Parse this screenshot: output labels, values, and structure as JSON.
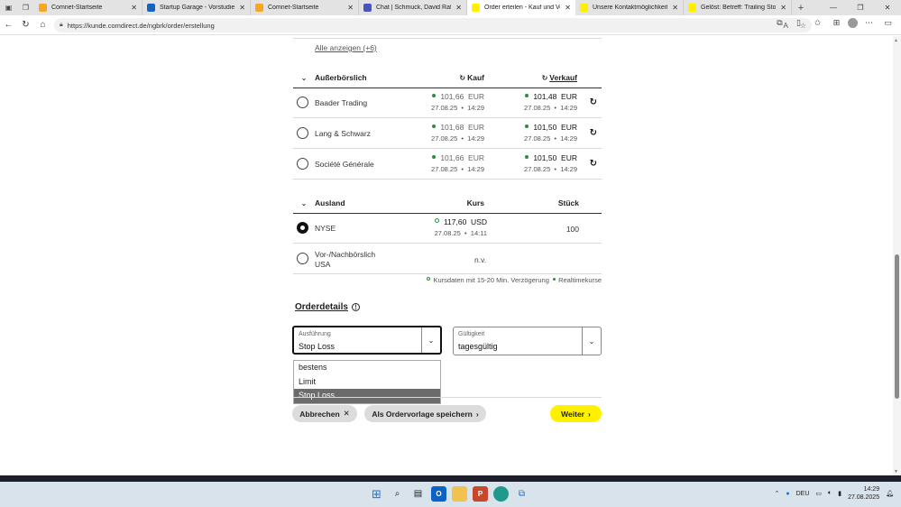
{
  "browser": {
    "tabs": [
      {
        "title": "Comnet-Startseite",
        "color": "#f5a623",
        "active": false
      },
      {
        "title": "Startup Garage - Vorstudie - Alli",
        "color": "#1565c0",
        "active": false
      },
      {
        "title": "Comnet-Startseite",
        "color": "#f5a623",
        "active": false
      },
      {
        "title": "Chat | Schmuck, David Rafael | M",
        "color": "#4b53bc",
        "active": false
      },
      {
        "title": "Order erteilen - Kauf und Verka",
        "color": "#fff000",
        "active": true
      },
      {
        "title": "Unsere Kontaktmöglichkeiten |",
        "color": "#fff000",
        "active": false
      },
      {
        "title": "Gelöst: Betreff: Trailing Stop-Lo",
        "color": "#fff000",
        "active": false
      }
    ],
    "url": "https://kunde.comdirect.de/ngbrk/order/erstellung"
  },
  "show_all_link": "Alle anzeigen (+6)",
  "offexchange": {
    "title": "Außerbörslich",
    "col_buy": "Kauf",
    "col_sell": "Verkauf",
    "rows": [
      {
        "name": "Baader Trading",
        "buy_price": "101,66",
        "buy_currency": "EUR",
        "buy_date": "27.08.25",
        "buy_time": "14:29",
        "sell_price": "101,48",
        "sell_currency": "EUR",
        "sell_date": "27.08.25",
        "sell_time": "14:29"
      },
      {
        "name": "Lang & Schwarz",
        "buy_price": "101,68",
        "buy_currency": "EUR",
        "buy_date": "27.08.25",
        "buy_time": "14:29",
        "sell_price": "101,50",
        "sell_currency": "EUR",
        "sell_date": "27.08.25",
        "sell_time": "14:29"
      },
      {
        "name": "Société Générale",
        "buy_price": "101,66",
        "buy_currency": "EUR",
        "buy_date": "27.08.25",
        "buy_time": "14:29",
        "sell_price": "101,50",
        "sell_currency": "EUR",
        "sell_date": "27.08.25",
        "sell_time": "14:29"
      }
    ]
  },
  "foreign": {
    "title": "Ausland",
    "col_price": "Kurs",
    "col_qty": "Stück",
    "rows": [
      {
        "name": "NYSE",
        "price": "117,60",
        "currency": "USD",
        "date": "27.08.25",
        "time": "14:11",
        "qty": "100",
        "selected": true
      },
      {
        "name_line1": "Vor-/Nachbörslich",
        "name_line2": "USA",
        "price": "n.v.",
        "selected": false
      }
    ]
  },
  "note": {
    "delayed": "Kursdaten mit 15-20 Min. Verzögerung",
    "realtime": "Realtimekurse"
  },
  "order_details": {
    "title": "Orderdetails",
    "execution": {
      "label": "Ausführung",
      "value": "Stop Loss"
    },
    "validity": {
      "label": "Gültigkeit",
      "value": "tagesgültig"
    },
    "options": [
      "bestens",
      "Limit",
      "Stop Loss"
    ],
    "selected_option": "Stop Loss"
  },
  "actions": {
    "cancel": "Abbrechen",
    "save_template": "Als Ordervorlage speichern",
    "next": "Weiter"
  },
  "taskbar": {
    "lang": "DEU",
    "time": "14:29",
    "date": "27.08.2025"
  }
}
